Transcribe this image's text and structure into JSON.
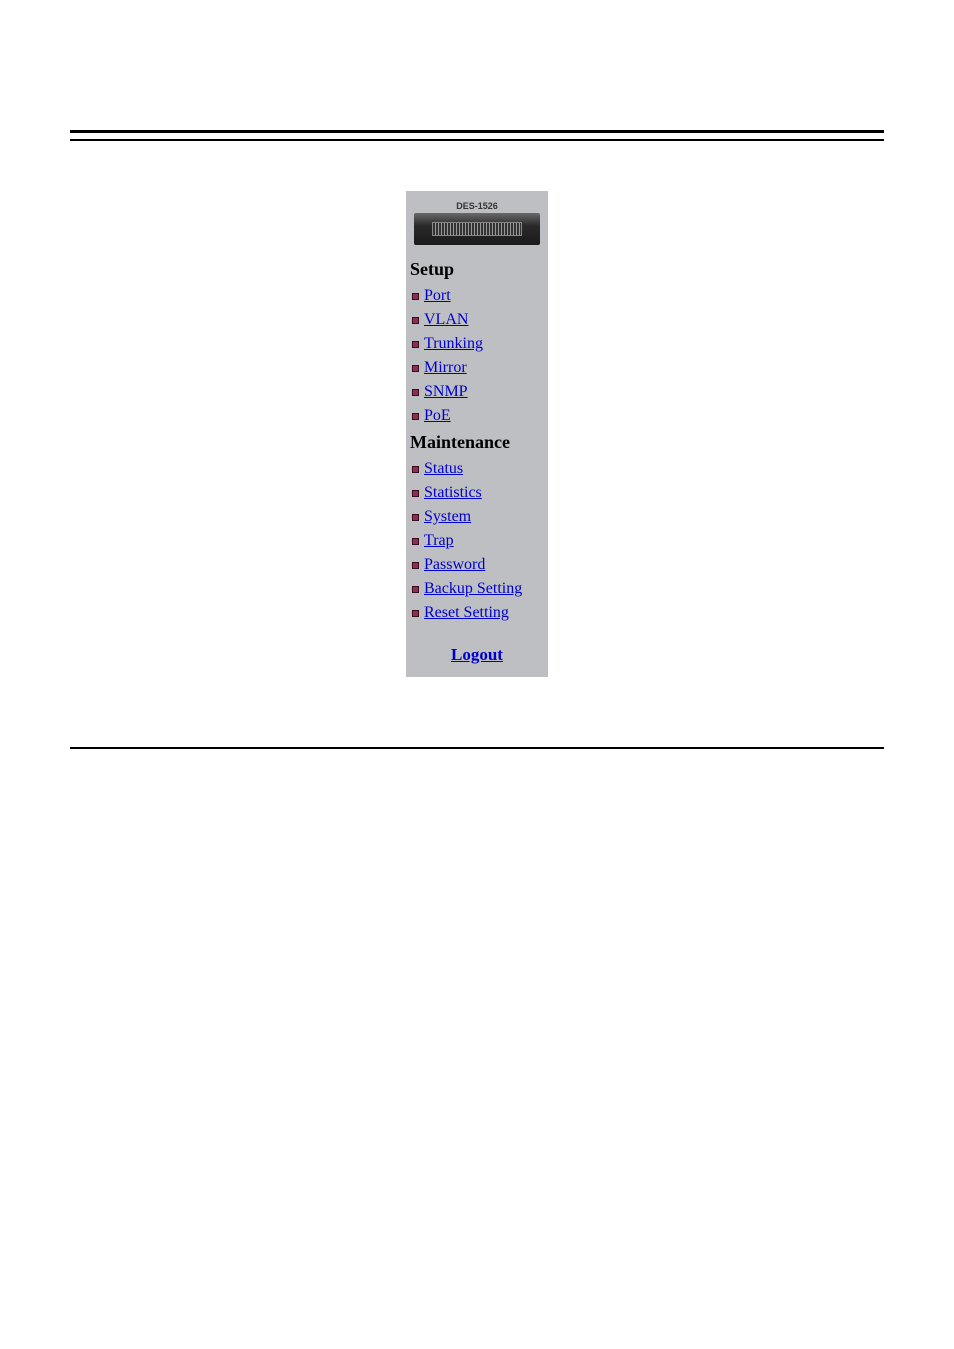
{
  "device": {
    "label": "DES-1526"
  },
  "sections": {
    "setup": {
      "heading": "Setup",
      "items": [
        "Port",
        "VLAN",
        "Trunking",
        "Mirror",
        "SNMP",
        "PoE"
      ]
    },
    "maintenance": {
      "heading": "Maintenance",
      "items": [
        "Status",
        "Statistics",
        "System",
        "Trap",
        "Password",
        "Backup Setting",
        "Reset Setting"
      ]
    }
  },
  "logout": {
    "label": "Logout"
  }
}
